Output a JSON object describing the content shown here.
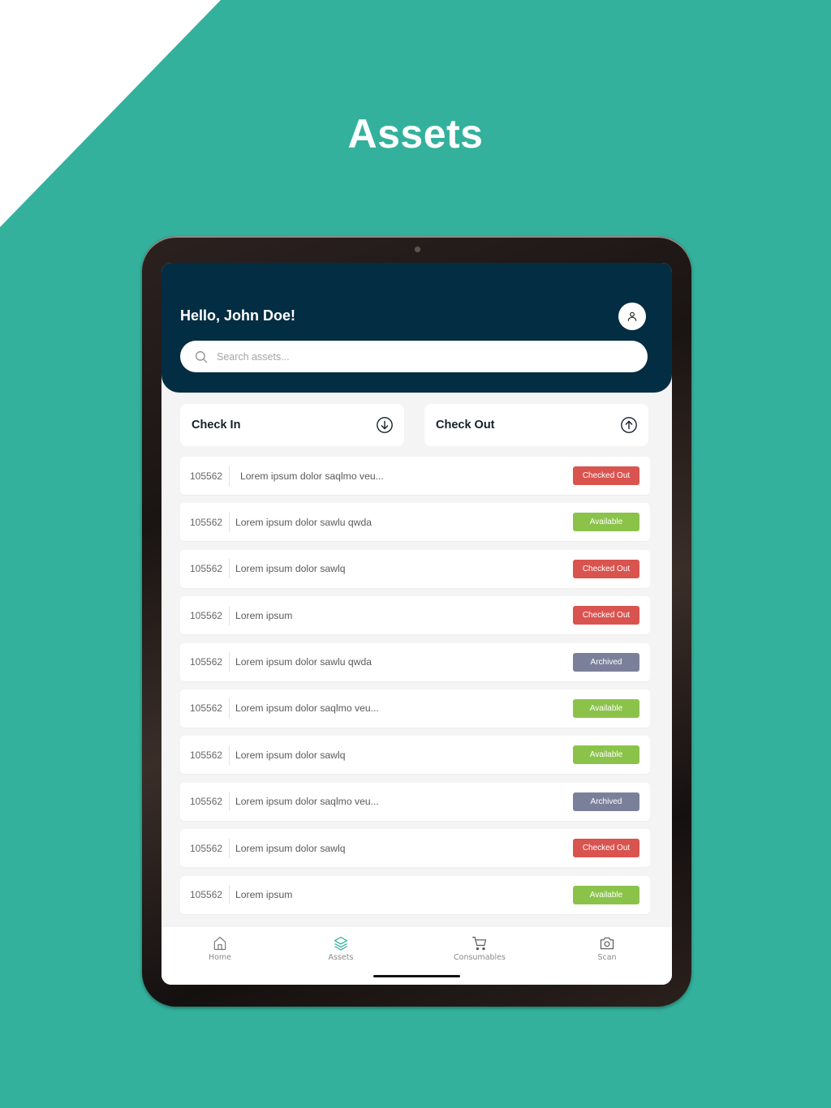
{
  "page": {
    "title": "Assets"
  },
  "header": {
    "greeting": "Hello, John Doe!",
    "avatar_icon": "user-icon",
    "search": {
      "placeholder": "Search assets...",
      "value": "",
      "icon": "search-icon"
    }
  },
  "actions": [
    {
      "label": "Check In",
      "icon": "arrow-down-circle-icon"
    },
    {
      "label": "Check Out",
      "icon": "arrow-up-circle-icon"
    }
  ],
  "status_colors": {
    "Checked Out": "#d9534f",
    "Available": "#8bc34a",
    "Archived": "#7b809a"
  },
  "assets": [
    {
      "id": "105562",
      "name": "Lorem ipsum dolor saqlmo veu...",
      "status": "Checked Out"
    },
    {
      "id": "105562",
      "name": "Lorem ipsum dolor sawlu qwda",
      "status": "Available"
    },
    {
      "id": "105562",
      "name": "Lorem ipsum dolor sawlq",
      "status": "Checked Out"
    },
    {
      "id": "105562",
      "name": "Lorem ipsum",
      "status": "Checked Out"
    },
    {
      "id": "105562",
      "name": "Lorem ipsum dolor sawlu qwda",
      "status": "Archived"
    },
    {
      "id": "105562",
      "name": "Lorem ipsum dolor saqlmo veu...",
      "status": "Available"
    },
    {
      "id": "105562",
      "name": "Lorem ipsum dolor sawlq",
      "status": "Available"
    },
    {
      "id": "105562",
      "name": "Lorem ipsum dolor saqlmo veu...",
      "status": "Archived"
    },
    {
      "id": "105562",
      "name": "Lorem ipsum dolor sawlq",
      "status": "Checked Out"
    },
    {
      "id": "105562",
      "name": "Lorem ipsum",
      "status": "Available"
    }
  ],
  "bottom_nav": {
    "items": [
      {
        "label": "Home",
        "icon": "home-icon",
        "active": false
      },
      {
        "label": "Assets",
        "icon": "layers-icon",
        "active": true
      },
      {
        "label": "Consumables",
        "icon": "cart-icon",
        "active": false
      },
      {
        "label": "Scan",
        "icon": "camera-icon",
        "active": false
      }
    ],
    "active_color": "#33b19c"
  },
  "colors": {
    "background": "#33b19c",
    "header": "#032d42"
  }
}
